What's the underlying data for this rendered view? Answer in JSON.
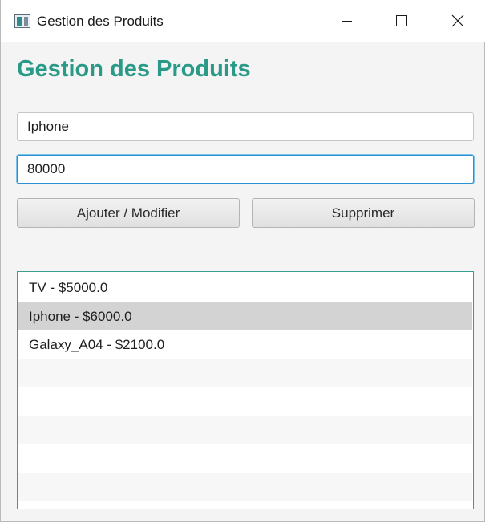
{
  "window": {
    "title": "Gestion des Produits",
    "icon": "app-window-icon",
    "controls": [
      "minimize-icon",
      "maximize-icon",
      "close-icon"
    ]
  },
  "header": {
    "title": "Gestion des Produits",
    "color": "#2a9a88"
  },
  "form": {
    "name_value": "Iphone",
    "price_value": "80000"
  },
  "actions": {
    "save_label": "Ajouter / Modifier",
    "delete_label": "Supprimer"
  },
  "products": {
    "items": [
      {
        "label": "TV - $5000.0"
      },
      {
        "label": "Iphone - $6000.0",
        "selected": true
      },
      {
        "label": "Galaxy_A04 - $2100.0"
      }
    ],
    "empty_rows": 5
  },
  "colors": {
    "accent": "#2a9a88",
    "focus_border": "#2b8fd1",
    "selected_row": "#d3d3d3",
    "list_border": "#3a9e8e"
  }
}
